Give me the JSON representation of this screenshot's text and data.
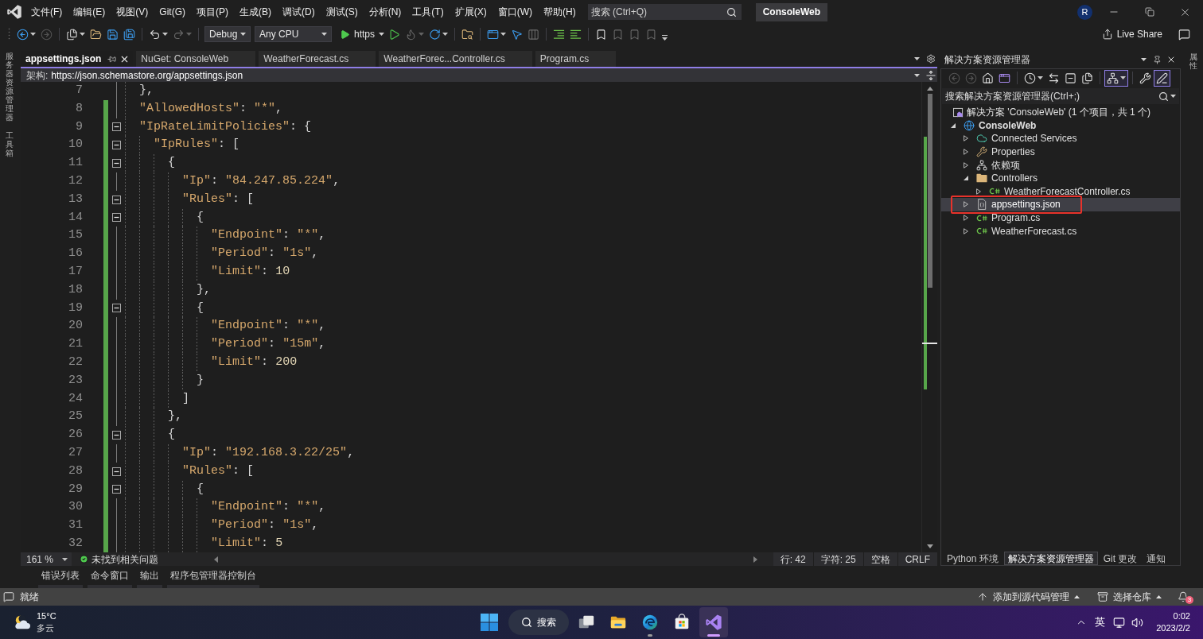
{
  "menu_bar": {
    "menus": [
      "文件(F)",
      "编辑(E)",
      "视图(V)",
      "Git(G)",
      "项目(P)",
      "生成(B)",
      "调试(D)",
      "测试(S)",
      "分析(N)",
      "工具(T)",
      "扩展(X)",
      "窗口(W)",
      "帮助(H)"
    ],
    "search": {
      "placeholder": "搜索 (Ctrl+Q)"
    },
    "solution_name": "ConsoleWeb",
    "account_initial": "R"
  },
  "toolbar": {
    "left_groups": [
      [
        {
          "kind": "back",
          "disabled": false,
          "dropdown": true
        },
        {
          "kind": "forward",
          "disabled": true,
          "dropdown": false
        }
      ],
      [
        {
          "kind": "new-item",
          "disabled": false,
          "dropdown": true
        },
        {
          "kind": "open",
          "disabled": false,
          "dropdown": false
        },
        {
          "kind": "save",
          "disabled": false,
          "dropdown": false
        },
        {
          "kind": "save-all",
          "disabled": false,
          "dropdown": false
        }
      ],
      [
        {
          "kind": "undo",
          "disabled": false,
          "dropdown": true
        },
        {
          "kind": "redo",
          "disabled": true,
          "dropdown": true
        }
      ]
    ],
    "configuration": "Debug",
    "platform": "Any CPU",
    "run_target": "https",
    "right_groups": [
      [
        {
          "kind": "run-without-debugging",
          "disabled": false,
          "dropdown": false
        },
        {
          "kind": "hot-reload",
          "disabled": true,
          "dropdown": true
        },
        {
          "kind": "restart",
          "disabled": false,
          "dropdown": true
        }
      ],
      [
        {
          "kind": "find-in-files",
          "disabled": false,
          "dropdown": false
        }
      ],
      [
        {
          "kind": "layout",
          "disabled": false,
          "dropdown": true
        },
        {
          "kind": "select-element",
          "disabled": false,
          "dropdown": false
        },
        {
          "kind": "columns",
          "disabled": true,
          "dropdown": false
        }
      ],
      [
        {
          "kind": "comment",
          "disabled": false,
          "dropdown": false
        },
        {
          "kind": "uncomment",
          "disabled": false,
          "dropdown": false
        }
      ],
      [
        {
          "kind": "bookmark",
          "disabled": false,
          "dropdown": false
        },
        {
          "kind": "bookmark-previous",
          "disabled": true,
          "dropdown": false
        },
        {
          "kind": "bookmark-next",
          "disabled": true,
          "dropdown": false
        },
        {
          "kind": "bookmark-clear",
          "disabled": true,
          "dropdown": false
        }
      ]
    ],
    "live_share": "Live Share"
  },
  "left_strip": [
    "服务器资源管理器",
    "工具箱"
  ],
  "editor": {
    "tabs": [
      {
        "label": "appsettings.json",
        "selected": true
      },
      {
        "label": "NuGet: ConsoleWeb",
        "selected": false
      },
      {
        "label": "WeatherForecast.cs",
        "selected": false
      },
      {
        "label": "WeatherForec...Controller.cs",
        "selected": false
      },
      {
        "label": "Program.cs",
        "selected": false
      }
    ],
    "schema": {
      "label": "架构:",
      "url": "https://json.schemastore.org/appsettings.json"
    },
    "lines": [
      {
        "number": "7",
        "text": "  },",
        "changed": false,
        "fold": false
      },
      {
        "number": "8",
        "text": "  \"AllowedHosts\": \"*\",",
        "changed": true,
        "fold": false
      },
      {
        "number": "9",
        "text": "  \"IpRateLimitPolicies\": {",
        "changed": true,
        "fold": true
      },
      {
        "number": "10",
        "text": "    \"IpRules\": [",
        "changed": true,
        "fold": true
      },
      {
        "number": "11",
        "text": "      {",
        "changed": true,
        "fold": true
      },
      {
        "number": "12",
        "text": "        \"Ip\": \"84.247.85.224\",",
        "changed": true,
        "fold": false
      },
      {
        "number": "13",
        "text": "        \"Rules\": [",
        "changed": true,
        "fold": true
      },
      {
        "number": "14",
        "text": "          {",
        "changed": true,
        "fold": true
      },
      {
        "number": "15",
        "text": "            \"Endpoint\": \"*\",",
        "changed": true,
        "fold": false
      },
      {
        "number": "16",
        "text": "            \"Period\": \"1s\",",
        "changed": true,
        "fold": false
      },
      {
        "number": "17",
        "text": "            \"Limit\": 10",
        "changed": true,
        "fold": false
      },
      {
        "number": "18",
        "text": "          },",
        "changed": true,
        "fold": false
      },
      {
        "number": "19",
        "text": "          {",
        "changed": true,
        "fold": true
      },
      {
        "number": "20",
        "text": "            \"Endpoint\": \"*\",",
        "changed": true,
        "fold": false
      },
      {
        "number": "21",
        "text": "            \"Period\": \"15m\",",
        "changed": true,
        "fold": false
      },
      {
        "number": "22",
        "text": "            \"Limit\": 200",
        "changed": true,
        "fold": false
      },
      {
        "number": "23",
        "text": "          }",
        "changed": true,
        "fold": false
      },
      {
        "number": "24",
        "text": "        ]",
        "changed": true,
        "fold": false
      },
      {
        "number": "25",
        "text": "      },",
        "changed": true,
        "fold": false
      },
      {
        "number": "26",
        "text": "      {",
        "changed": true,
        "fold": true
      },
      {
        "number": "27",
        "text": "        \"Ip\": \"192.168.3.22/25\",",
        "changed": true,
        "fold": false
      },
      {
        "number": "28",
        "text": "        \"Rules\": [",
        "changed": true,
        "fold": true
      },
      {
        "number": "29",
        "text": "          {",
        "changed": true,
        "fold": true
      },
      {
        "number": "30",
        "text": "            \"Endpoint\": \"*\",",
        "changed": true,
        "fold": false
      },
      {
        "number": "31",
        "text": "            \"Period\": \"1s\",",
        "changed": true,
        "fold": false
      },
      {
        "number": "32",
        "text": "            \"Limit\": 5",
        "changed": true,
        "fold": false
      }
    ],
    "status": {
      "zoom": "161 %",
      "issues": "未找到相关问题",
      "line": "行: 42",
      "column": "字符: 25",
      "indentation": "空格",
      "line_ending": "CRLF"
    }
  },
  "solution_explorer": {
    "title": "解决方案资源管理器",
    "tool_groups": [
      [
        {
          "kind": "back",
          "disabled": true,
          "on": false,
          "dropdown": false
        },
        {
          "kind": "forward",
          "disabled": true,
          "on": false,
          "dropdown": false
        },
        {
          "kind": "home",
          "disabled": false,
          "on": false,
          "dropdown": false
        },
        {
          "kind": "switch-views",
          "disabled": false,
          "on": false,
          "dropdown": false
        }
      ],
      [
        {
          "kind": "pending-changes-filter",
          "disabled": false,
          "on": false,
          "dropdown": true
        },
        {
          "kind": "sync",
          "disabled": false,
          "on": false,
          "dropdown": false
        },
        {
          "kind": "collapse-all",
          "disabled": false,
          "on": false,
          "dropdown": false
        },
        {
          "kind": "show-all-files",
          "disabled": false,
          "on": false,
          "dropdown": false
        }
      ],
      [
        {
          "kind": "tree-view",
          "disabled": false,
          "on": true,
          "dropdown": true
        }
      ],
      [
        {
          "kind": "properties",
          "disabled": false,
          "on": false,
          "dropdown": false
        },
        {
          "kind": "preview",
          "disabled": false,
          "on": true,
          "dropdown": false
        }
      ]
    ],
    "search": {
      "placeholder": "搜索解决方案资源管理器(Ctrl+;)"
    },
    "solution": "解决方案 'ConsoleWeb' (1 个项目，共 1 个)",
    "tree": [
      {
        "label": "ConsoleWeb",
        "kind": "project",
        "expanded": true,
        "selected": false,
        "annotated": false,
        "children": [
          {
            "label": "Connected Services",
            "kind": "connected-services",
            "expanded": false,
            "selected": false,
            "annotated": false
          },
          {
            "label": "Properties",
            "kind": "properties",
            "expanded": false,
            "selected": false,
            "annotated": false
          },
          {
            "label": "依赖项",
            "kind": "dependencies",
            "expanded": false,
            "selected": false,
            "annotated": false
          },
          {
            "label": "Controllers",
            "kind": "folder",
            "expanded": true,
            "selected": false,
            "annotated": false,
            "children": [
              {
                "label": "WeatherForecastController.cs",
                "kind": "csharp",
                "expanded": false,
                "selected": false,
                "annotated": false
              }
            ]
          },
          {
            "label": "appsettings.json",
            "kind": "json",
            "expanded": false,
            "selected": true,
            "annotated": true
          },
          {
            "label": "Program.cs",
            "kind": "csharp",
            "expanded": false,
            "selected": false,
            "annotated": false
          },
          {
            "label": "WeatherForecast.cs",
            "kind": "csharp",
            "expanded": false,
            "selected": false,
            "annotated": false
          }
        ]
      }
    ],
    "tabs": [
      {
        "label": "Python 环境",
        "selected": false
      },
      {
        "label": "解决方案资源管理器",
        "selected": true
      },
      {
        "label": "Git 更改",
        "selected": false
      },
      {
        "label": "通知",
        "selected": false
      }
    ]
  },
  "right_strip": [
    "属性"
  ],
  "tool_tabs": [
    {
      "label": "错误列表",
      "selected": false
    },
    {
      "label": "命令窗口",
      "selected": false
    },
    {
      "label": "输出",
      "selected": false
    },
    {
      "label": "程序包管理器控制台",
      "selected": false
    }
  ],
  "status_bar": {
    "message": "就绪",
    "source_control": "添加到源代码管理",
    "repository": "选择仓库",
    "notification_count": "3"
  },
  "taskbar": {
    "weather": {
      "temperature": "15°C",
      "condition": "多云"
    },
    "search_label": "搜索",
    "apps": [
      {
        "kind": "task-view",
        "selected": false,
        "running": false
      },
      {
        "kind": "file-explorer",
        "selected": false,
        "running": false
      },
      {
        "kind": "browser",
        "selected": false,
        "running": true
      },
      {
        "kind": "store",
        "selected": false,
        "running": false
      },
      {
        "kind": "visual-studio",
        "selected": true,
        "running": true
      }
    ],
    "input_method": "英",
    "time": "0:02",
    "date": "2023/2/2"
  }
}
